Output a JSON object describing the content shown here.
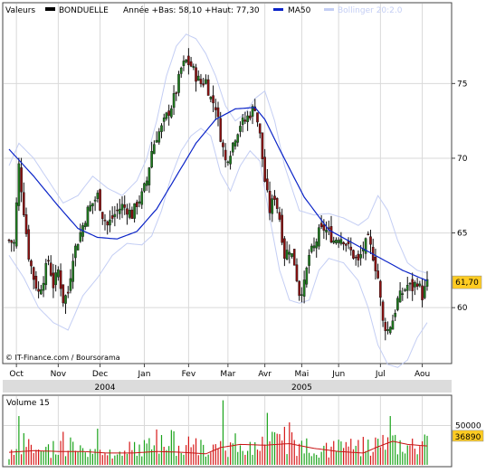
{
  "legend": {
    "label_valeurs": "Valeurs",
    "ticker": "BONDUELLE",
    "range_text": "Année +Bas: 58,10 +Haut: 77,30",
    "ma_label": "MA50",
    "bollinger_label": "Bollinger 20:2.0"
  },
  "copyright": "© IT-Finance.com / Boursorama",
  "colors": {
    "panel_bg": "#ffffff",
    "frame": "#444444",
    "grid": "#d9d9d9",
    "ma": "#0b24c8",
    "bollinger": "#c4cef4",
    "price_up": "#1e7a1e",
    "price_down": "#8b1010",
    "last_price_bg": "#ffcc22",
    "volume_up": "#1aa31a",
    "volume_down": "#d61818",
    "volume_avg": "#c81414",
    "year_band": "#dcdcdc"
  },
  "chart_data": [
    {
      "type": "candlestick",
      "x_labels": [
        "Oct",
        "Nov",
        "Dec",
        "Jan",
        "Fev",
        "Mar",
        "Avr",
        "Mai",
        "Jun",
        "Jul",
        "Aou"
      ],
      "year_labels": [
        "2004",
        "2005"
      ],
      "y_ticks": [
        60,
        65,
        70,
        75
      ],
      "ylim": [
        56.5,
        79.5
      ],
      "last_price": 61.7,
      "last_price_label": "61,70",
      "close_anchors": [
        [
          0,
          64.5
        ],
        [
          2,
          64.3
        ],
        [
          4,
          69.5
        ],
        [
          6,
          66.5
        ],
        [
          8,
          63.5
        ],
        [
          10,
          62.0
        ],
        [
          12,
          61.0
        ],
        [
          14,
          62.0
        ],
        [
          16,
          63.2
        ],
        [
          18,
          61.5
        ],
        [
          20,
          62.5
        ],
        [
          22,
          60.5
        ],
        [
          24,
          61.0
        ],
        [
          26,
          63.5
        ],
        [
          28,
          64.5
        ],
        [
          30,
          65.5
        ],
        [
          32,
          66.5
        ],
        [
          34,
          67.0
        ],
        [
          36,
          67.5
        ],
        [
          38,
          66.2
        ],
        [
          40,
          65.5
        ],
        [
          42,
          66.0
        ],
        [
          44,
          66.5
        ],
        [
          46,
          66.8
        ],
        [
          48,
          66.6
        ],
        [
          50,
          66.2
        ],
        [
          52,
          67.0
        ],
        [
          54,
          67.5
        ],
        [
          56,
          68.5
        ],
        [
          58,
          70.5
        ],
        [
          60,
          71.5
        ],
        [
          62,
          72.0
        ],
        [
          64,
          72.8
        ],
        [
          66,
          73.5
        ],
        [
          68,
          74.5
        ],
        [
          70,
          76.0
        ],
        [
          72,
          76.5
        ],
        [
          74,
          76.2
        ],
        [
          76,
          75.5
        ],
        [
          78,
          75.0
        ],
        [
          80,
          75.2
        ],
        [
          82,
          74.0
        ],
        [
          84,
          73.5
        ],
        [
          86,
          71.5
        ],
        [
          88,
          69.8
        ],
        [
          90,
          70.5
        ],
        [
          92,
          71.5
        ],
        [
          94,
          72.3
        ],
        [
          96,
          72.5
        ],
        [
          98,
          73.0
        ],
        [
          100,
          73.5
        ],
        [
          102,
          71.5
        ],
        [
          104,
          68.5
        ],
        [
          106,
          66.5
        ],
        [
          108,
          67.5
        ],
        [
          110,
          66.0
        ],
        [
          112,
          63.5
        ],
        [
          114,
          64.0
        ],
        [
          116,
          63.0
        ],
        [
          118,
          61.0
        ],
        [
          120,
          61.5
        ],
        [
          122,
          63.5
        ],
        [
          124,
          64.0
        ],
        [
          126,
          65.0
        ],
        [
          128,
          65.3
        ],
        [
          130,
          65.0
        ],
        [
          132,
          64.5
        ],
        [
          134,
          64.8
        ],
        [
          136,
          64.6
        ],
        [
          138,
          64.0
        ],
        [
          140,
          63.5
        ],
        [
          142,
          63.0
        ],
        [
          144,
          64.0
        ],
        [
          146,
          64.5
        ],
        [
          148,
          63.5
        ],
        [
          150,
          62.0
        ],
        [
          152,
          59.0
        ],
        [
          154,
          58.5
        ],
        [
          156,
          59.2
        ],
        [
          158,
          60.5
        ],
        [
          160,
          61.0
        ],
        [
          162,
          61.5
        ],
        [
          164,
          61.3
        ],
        [
          166,
          61.8
        ],
        [
          168,
          60.8
        ],
        [
          170,
          61.6
        ]
      ],
      "ma50_anchors": [
        [
          0,
          70.6
        ],
        [
          10,
          68.8
        ],
        [
          20,
          66.8
        ],
        [
          28,
          65.3
        ],
        [
          36,
          64.7
        ],
        [
          44,
          64.6
        ],
        [
          52,
          65.1
        ],
        [
          60,
          66.6
        ],
        [
          68,
          68.8
        ],
        [
          76,
          71.0
        ],
        [
          84,
          72.6
        ],
        [
          92,
          73.3
        ],
        [
          100,
          73.4
        ],
        [
          104,
          72.6
        ],
        [
          110,
          70.6
        ],
        [
          120,
          67.4
        ],
        [
          130,
          65.2
        ],
        [
          140,
          64.3
        ],
        [
          150,
          63.4
        ],
        [
          160,
          62.5
        ],
        [
          170,
          61.8
        ]
      ],
      "bollinger_upper": [
        [
          0,
          69.5
        ],
        [
          4,
          71.0
        ],
        [
          10,
          70.0
        ],
        [
          16,
          68.5
        ],
        [
          22,
          67.0
        ],
        [
          28,
          67.5
        ],
        [
          34,
          68.8
        ],
        [
          40,
          68.0
        ],
        [
          46,
          67.5
        ],
        [
          52,
          68.5
        ],
        [
          56,
          70.0
        ],
        [
          60,
          72.5
        ],
        [
          64,
          75.5
        ],
        [
          68,
          77.5
        ],
        [
          72,
          78.3
        ],
        [
          76,
          78.0
        ],
        [
          80,
          77.0
        ],
        [
          84,
          75.5
        ],
        [
          88,
          73.5
        ],
        [
          92,
          72.5
        ],
        [
          96,
          73.0
        ],
        [
          100,
          74.0
        ],
        [
          104,
          74.5
        ],
        [
          108,
          72.5
        ],
        [
          112,
          69.5
        ],
        [
          118,
          66.5
        ],
        [
          124,
          66.2
        ],
        [
          130,
          66.3
        ],
        [
          136,
          66.0
        ],
        [
          142,
          65.5
        ],
        [
          146,
          66.0
        ],
        [
          150,
          67.5
        ],
        [
          154,
          66.5
        ],
        [
          158,
          64.5
        ],
        [
          162,
          63.0
        ],
        [
          166,
          62.5
        ],
        [
          170,
          62.3
        ]
      ],
      "bollinger_lower": [
        [
          0,
          63.5
        ],
        [
          6,
          62.0
        ],
        [
          12,
          60.0
        ],
        [
          18,
          59.0
        ],
        [
          24,
          58.5
        ],
        [
          30,
          60.8
        ],
        [
          36,
          62.0
        ],
        [
          42,
          63.5
        ],
        [
          48,
          64.3
        ],
        [
          54,
          64.2
        ],
        [
          58,
          64.8
        ],
        [
          62,
          66.5
        ],
        [
          66,
          68.8
        ],
        [
          70,
          70.5
        ],
        [
          74,
          71.5
        ],
        [
          78,
          72.0
        ],
        [
          82,
          71.5
        ],
        [
          86,
          69.0
        ],
        [
          90,
          67.8
        ],
        [
          94,
          69.5
        ],
        [
          98,
          70.5
        ],
        [
          102,
          69.8
        ],
        [
          106,
          66.0
        ],
        [
          110,
          62.5
        ],
        [
          114,
          60.5
        ],
        [
          118,
          60.3
        ],
        [
          122,
          60.5
        ],
        [
          126,
          62.5
        ],
        [
          130,
          63.3
        ],
        [
          136,
          63.0
        ],
        [
          142,
          61.8
        ],
        [
          146,
          60.0
        ],
        [
          150,
          57.5
        ],
        [
          154,
          56.2
        ],
        [
          158,
          56.0
        ],
        [
          162,
          56.5
        ],
        [
          166,
          58.0
        ],
        [
          170,
          59.0
        ]
      ]
    },
    {
      "type": "bar",
      "title": "Volume 15",
      "y_tick_label": "50000",
      "last_volume_label": "36890",
      "ylim": [
        0,
        85000
      ],
      "y_tick_value": 50000,
      "last_volume": 36890,
      "volume_anchors": [
        [
          0,
          14000
        ],
        [
          6,
          34000
        ],
        [
          10,
          26000
        ],
        [
          16,
          22000
        ],
        [
          22,
          30000
        ],
        [
          30,
          27000
        ],
        [
          40,
          21000
        ],
        [
          50,
          24000
        ],
        [
          60,
          31000
        ],
        [
          66,
          38000
        ],
        [
          70,
          26000
        ],
        [
          78,
          29000
        ],
        [
          86,
          25000
        ],
        [
          96,
          23000
        ],
        [
          104,
          33000
        ],
        [
          112,
          39000
        ],
        [
          120,
          28000
        ],
        [
          130,
          24000
        ],
        [
          140,
          27000
        ],
        [
          150,
          34000
        ],
        [
          158,
          31000
        ],
        [
          164,
          29000
        ],
        [
          170,
          36890
        ]
      ],
      "volume_spikes": [
        [
          4,
          62000
        ],
        [
          22,
          42000
        ],
        [
          36,
          46000
        ],
        [
          60,
          45000
        ],
        [
          73,
          36000
        ],
        [
          87,
          82000
        ],
        [
          92,
          40000
        ],
        [
          105,
          66000
        ],
        [
          114,
          54000
        ],
        [
          134,
          32000
        ],
        [
          155,
          62000
        ],
        [
          170,
          36890
        ]
      ],
      "volume_avg_anchors": [
        [
          0,
          16000
        ],
        [
          10,
          18000
        ],
        [
          20,
          17000
        ],
        [
          30,
          17000
        ],
        [
          40,
          15000
        ],
        [
          50,
          15000
        ],
        [
          60,
          17000
        ],
        [
          70,
          16000
        ],
        [
          80,
          14000
        ],
        [
          86,
          22000
        ],
        [
          94,
          26000
        ],
        [
          104,
          25000
        ],
        [
          114,
          27000
        ],
        [
          124,
          21000
        ],
        [
          134,
          17000
        ],
        [
          144,
          15000
        ],
        [
          150,
          23000
        ],
        [
          156,
          30000
        ],
        [
          162,
          26000
        ],
        [
          170,
          24000
        ]
      ]
    }
  ]
}
